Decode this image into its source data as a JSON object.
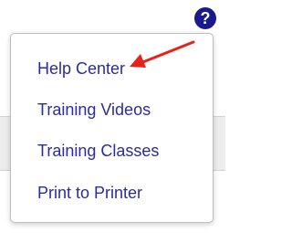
{
  "help_button": {
    "icon": "question-circle-icon",
    "glyph": "?",
    "color": "#1a1a8c"
  },
  "menu": {
    "items": [
      {
        "label": "Help Center"
      },
      {
        "label": "Training Videos"
      },
      {
        "label": "Training Classes"
      },
      {
        "label": "Print to Printer"
      }
    ],
    "link_color": "#2c2c9b"
  },
  "annotation": {
    "type": "red-arrow-icon",
    "color": "#e8221b",
    "points_to": "Help Center"
  }
}
